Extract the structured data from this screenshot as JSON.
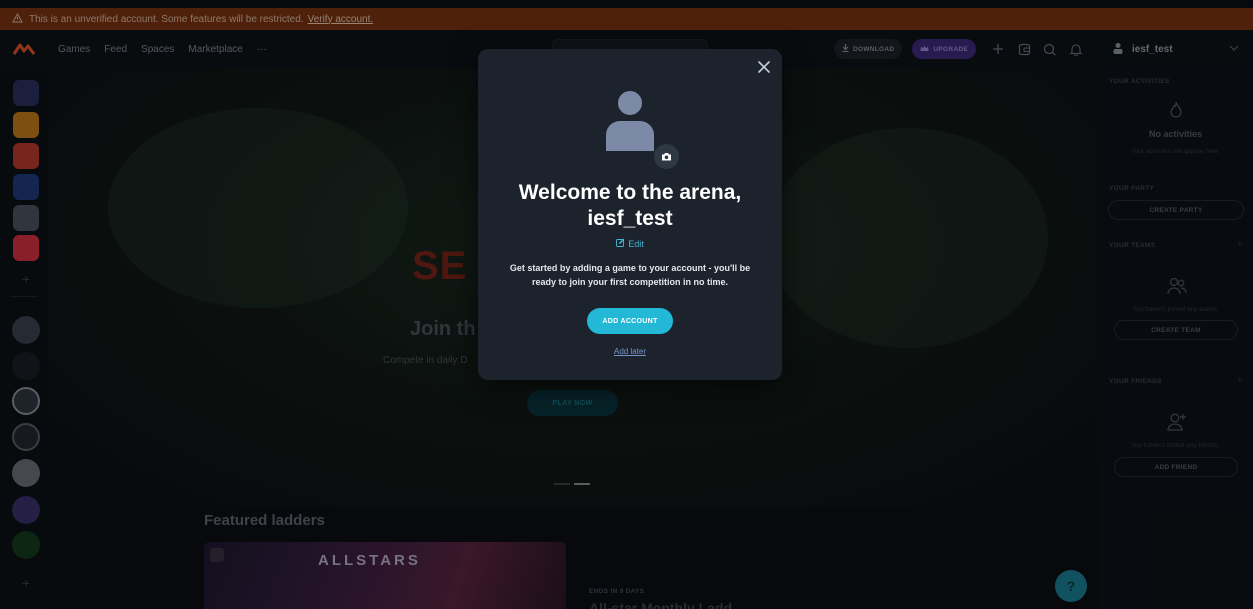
{
  "banner": {
    "message": "This is an unverified account. Some features will be restricted.",
    "link": "Verify account."
  },
  "nav": {
    "links": [
      "Games",
      "Feed",
      "Spaces",
      "Marketplace",
      "···"
    ],
    "download_label": "DOWNLOAD",
    "upgrade_label": "UPGRADE",
    "username": "iesf_test"
  },
  "hero": {
    "title_fragment": "SE",
    "join_fragment": "Join th",
    "subtitle_fragment": "Compete in daily D",
    "play_label": "PLAY NOW"
  },
  "featured": {
    "title": "Featured ladders",
    "card_logo": "ALLSTARS",
    "ends_label": "ENDS IN 9 DAYS",
    "ladder_name": "All-star Monthly Ladd"
  },
  "sidebar": {
    "activities": {
      "heading": "YOUR ACTIVITIES",
      "empty_title": "No activities",
      "empty_sub": "Your activities will appear here."
    },
    "party": {
      "heading": "YOUR PARTY",
      "button": "CREATE PARTY"
    },
    "teams": {
      "heading": "YOUR TEAMS",
      "plus": "+",
      "empty_sub": "You haven't joined any teams.",
      "button": "CREATE TEAM"
    },
    "friends": {
      "heading": "YOUR FRIENDS",
      "plus": "+",
      "empty_sub": "You haven't added any friends.",
      "button": "ADD FRIEND"
    }
  },
  "modal": {
    "welcome_line1": "Welcome to the arena,",
    "welcome_line2": "iesf_test",
    "edit_label": "Edit",
    "description": "Get started by adding a game to your account - you'll be ready to join your first competition in no time.",
    "primary_button": "ADD ACCOUNT",
    "secondary_link": "Add later"
  },
  "help": {
    "label": "?"
  },
  "colors": {
    "accent": "#22b8d6",
    "banner": "#7a3412",
    "modal_bg": "#1c232c",
    "upgrade": "#3d2a7a"
  },
  "icons": [
    "logo-icon",
    "warning-icon",
    "download-icon",
    "crown-icon",
    "plus-icon",
    "wallet-icon",
    "chat-icon",
    "bell-icon",
    "user-icon",
    "chevron-down-icon",
    "close-icon",
    "camera-icon",
    "edit-icon",
    "flame-icon",
    "team-icon",
    "add-friend-icon"
  ]
}
